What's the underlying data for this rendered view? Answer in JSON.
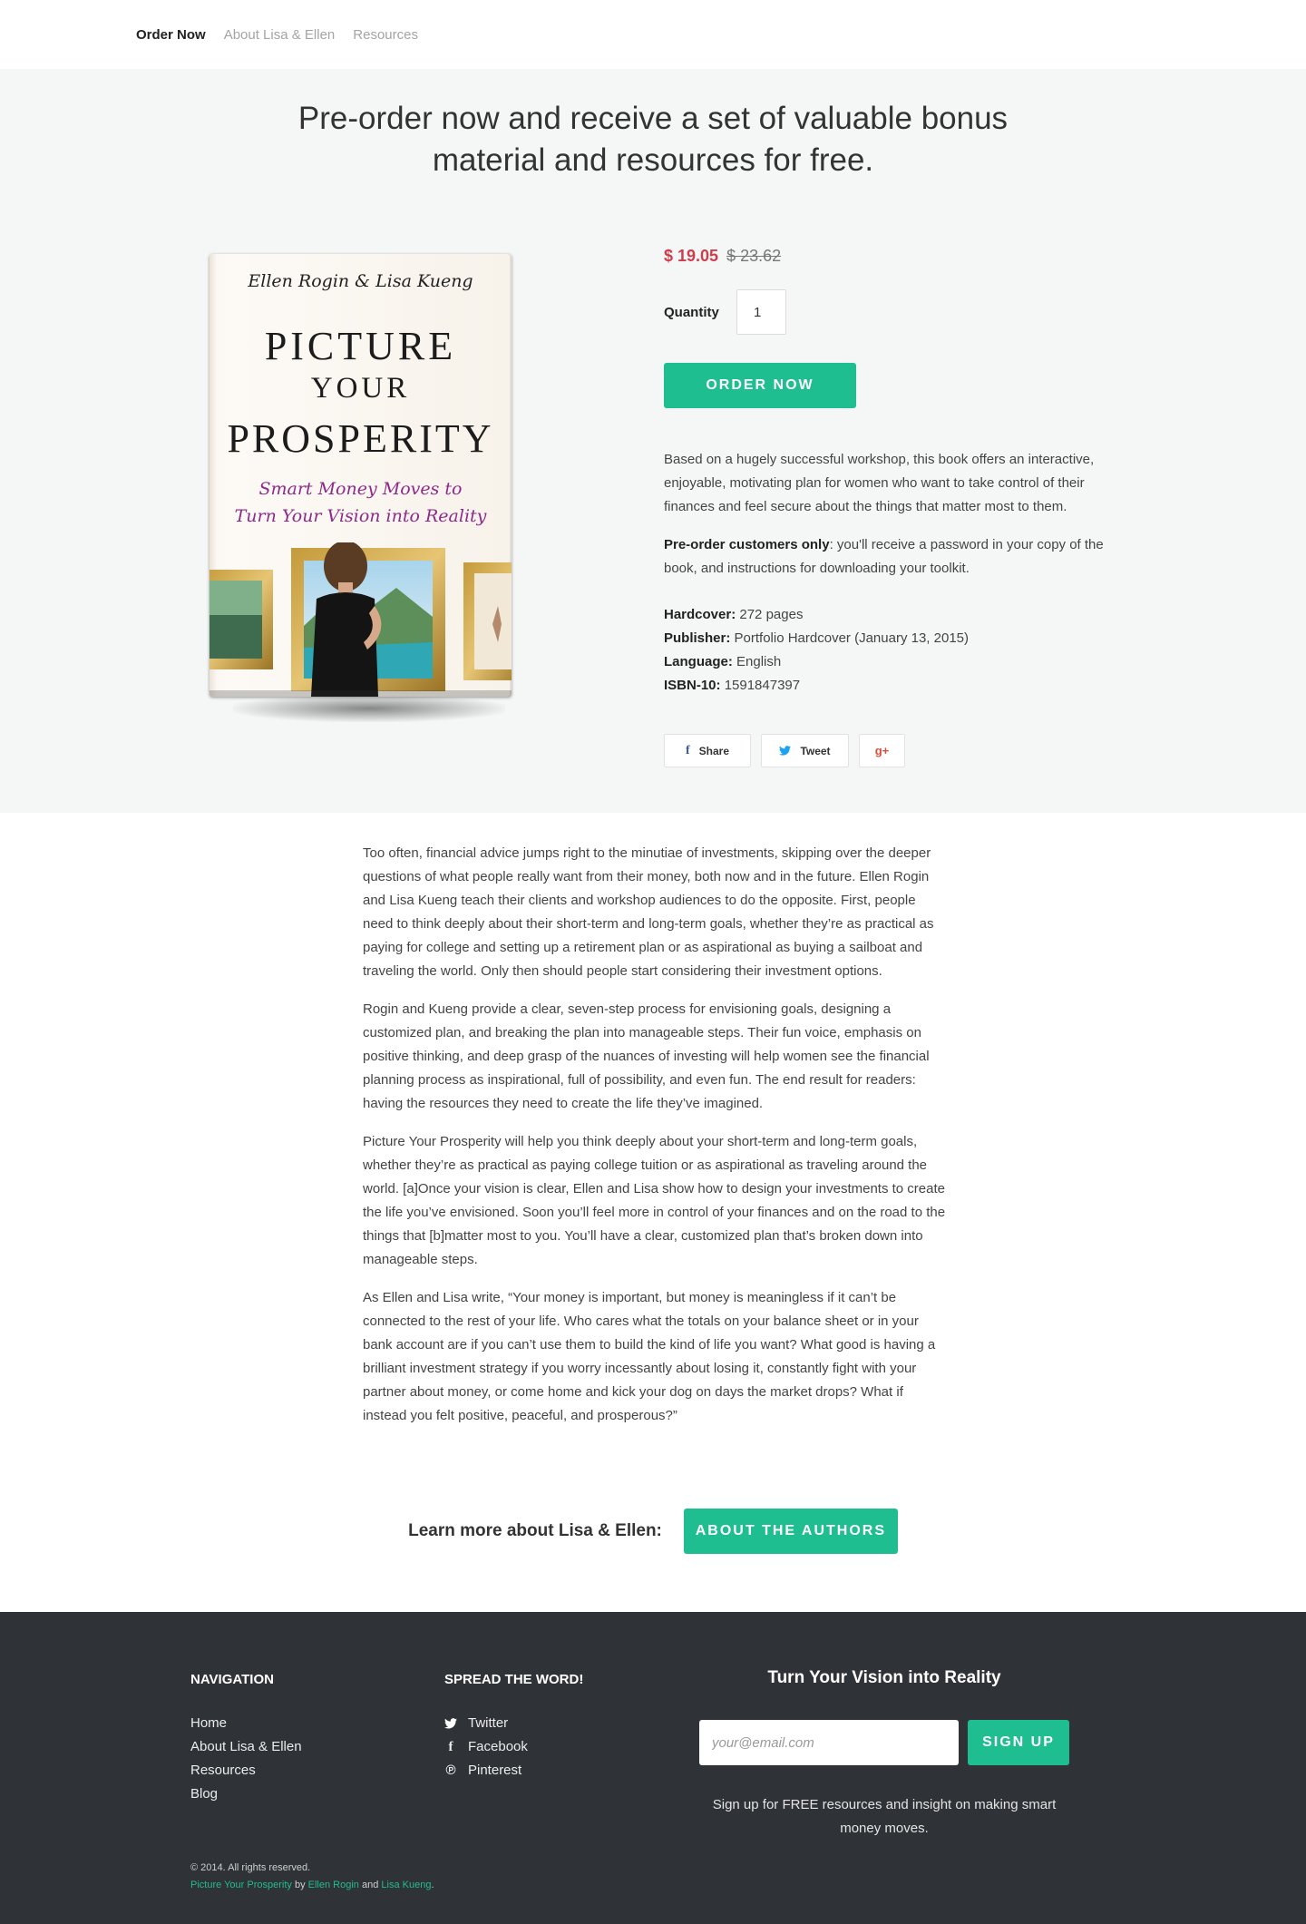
{
  "nav": {
    "items": [
      "Order Now",
      "About Lisa & Ellen",
      "Resources"
    ]
  },
  "hero": {
    "headline_line1": "Pre-order now and receive a set of valuable bonus",
    "headline_line2": "material and resources for free."
  },
  "book": {
    "authors": "Ellen Rogin & Lisa Kueng",
    "title_line1": "PICTURE",
    "title_line2": "YOUR",
    "title_line3": "PROSPERITY",
    "subtitle_line1": "Smart Money Moves to",
    "subtitle_line2": "Turn Your Vision into Reality"
  },
  "purchase": {
    "price": "$ 19.05",
    "original_price": "$ 23.62",
    "quantity_label": "Quantity",
    "quantity_value": "1",
    "order_button": "ORDER NOW"
  },
  "description": {
    "paragraph": "Based on a hugely successful workshop, this book offers an interactive, enjoyable, motivating plan for women who want to take control of their finances and feel secure about the things that matter most to them.",
    "preorder_bold": "Pre-order customers only",
    "preorder_rest": ": you'll receive a password in your copy of the book, and instructions for downloading your toolkit."
  },
  "details": [
    {
      "label": "Hardcover:",
      "value": "272 pages"
    },
    {
      "label": "Publisher:",
      "value": "Portfolio Hardcover (January 13, 2015)"
    },
    {
      "label": "Language:",
      "value": "English"
    },
    {
      "label": "ISBN-10:",
      "value": "1591847397"
    }
  ],
  "share": {
    "facebook": "Share",
    "twitter": "Tweet",
    "googleplus_icon": "g+"
  },
  "article": [
    "Too often, financial advice jumps right to the minutiae of investments, skipping over the deeper questions of what people really want from their money, both now and in the future. Ellen Rogin and Lisa Kueng teach their clients and workshop audiences to do the opposite. First, people need to think deeply about their short-term and long-term goals, whether they’re as practical as paying for college and setting up a retirement plan or as aspirational as buying a sailboat and traveling the world. Only then should people start considering their investment options.",
    "Rogin and Kueng provide a clear, seven-step process for envisioning goals, designing a customized plan, and breaking the plan into manageable steps. Their fun voice, emphasis on positive thinking, and deep grasp of the nuances of investing will help women see the financial planning process as inspirational, full of possibility, and even fun. The end result for readers: having the resources they need to create the life they’ve imagined.",
    "Picture Your Prosperity will help you think deeply about your short-term and long-term goals, whether they’re as practical as paying college tuition or as aspirational as traveling around the world. [a]Once your vision is clear, Ellen and Lisa show how to design your investments to create the life you’ve envisioned. Soon you’ll feel more in control of your finances and on the road to the things that [b]matter most to you. You’ll have a clear, customized plan that’s broken down into manageable steps.",
    "As Ellen and Lisa write, “Your money is important, but money is meaningless if it can’t be connected to the rest of your life. Who cares what the totals on your balance sheet or in your bank account are if you can’t use them to build the kind of life you want? What good is having a brilliant investment strategy if you worry incessantly about losing it, constantly fight with your partner about money, or come home and kick your dog on days the market drops? What if instead you felt positive, peaceful, and prosperous?”"
  ],
  "cta": {
    "label": "Learn more about Lisa & Ellen:",
    "button": "ABOUT THE AUTHORS"
  },
  "footer": {
    "nav_heading": "NAVIGATION",
    "nav_items": [
      "Home",
      "About Lisa & Ellen",
      "Resources",
      "Blog"
    ],
    "spread_heading": "SPREAD THE WORD!",
    "social": [
      {
        "icon": "twitter-icon",
        "label": "Twitter"
      },
      {
        "icon": "facebook-icon",
        "label": "Facebook"
      },
      {
        "icon": "pinterest-icon",
        "label": "Pinterest"
      }
    ],
    "signup_title": "Turn Your Vision into Reality",
    "email_placeholder": "your@email.com",
    "signup_button": "SIGN UP",
    "signup_note_line1": "Sign up for FREE resources and insight on making smart",
    "signup_note_line2": "money moves.",
    "copyright": "© 2014. All rights reserved.",
    "credit_book": "Picture Your Prosperity",
    "credit_by": "by",
    "credit_author1": "Ellen Rogin",
    "credit_and": "and",
    "credit_author2": "Lisa Kueng",
    "credit_end": "."
  },
  "colors": {
    "accent": "#1fbe91",
    "price": "#cf3d4c",
    "footer_bg": "#2f3236",
    "hero_bg": "#f5f7f6",
    "book_subtitle": "#8e2a8a"
  }
}
